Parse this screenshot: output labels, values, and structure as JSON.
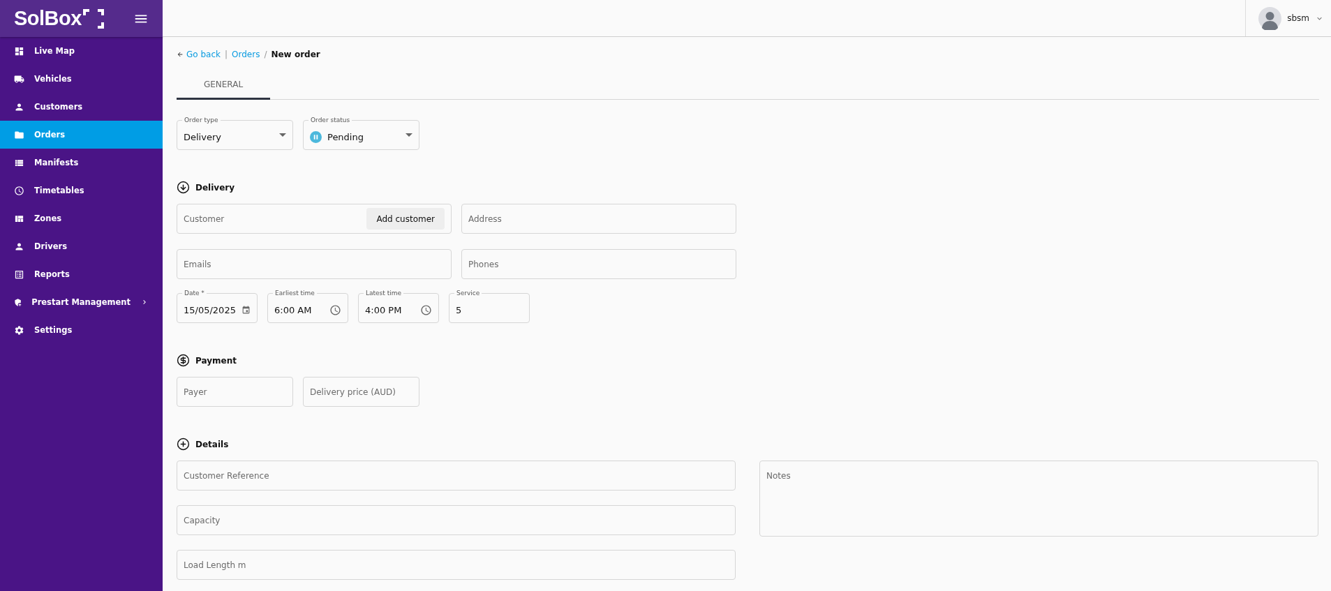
{
  "brand": {
    "name": "SolBox"
  },
  "sidebar": {
    "items": [
      {
        "label": "Live Map",
        "selected": false
      },
      {
        "label": "Vehicles",
        "selected": false
      },
      {
        "label": "Customers",
        "selected": false
      },
      {
        "label": "Orders",
        "selected": true
      },
      {
        "label": "Manifests",
        "selected": false
      },
      {
        "label": "Timetables",
        "selected": false
      },
      {
        "label": "Zones",
        "selected": false
      },
      {
        "label": "Drivers",
        "selected": false
      },
      {
        "label": "Reports",
        "selected": false
      },
      {
        "label": "Prestart Management",
        "selected": false,
        "has_submenu": true
      },
      {
        "label": "Settings",
        "selected": false
      }
    ]
  },
  "header": {
    "user": "sbsm"
  },
  "breadcrumb": {
    "back": "Go back",
    "separator": "|",
    "links": [
      "Orders"
    ],
    "divider": "/",
    "current": "New order"
  },
  "tabs": [
    {
      "label": "GENERAL",
      "selected": true
    }
  ],
  "selects": [
    {
      "label": "Order type",
      "value": "Delivery",
      "kind": "plain"
    },
    {
      "label": "Order status",
      "value": "Pending",
      "kind": "status"
    }
  ],
  "sections": [
    {
      "kind": "delivery",
      "title": "Delivery",
      "fields": [
        {
          "kind": "text",
          "placeholder": "Customer",
          "button": "Add customer"
        },
        {
          "kind": "text",
          "placeholder": "Address"
        },
        {
          "kind": "text",
          "placeholder": "Emails"
        },
        {
          "kind": "text",
          "placeholder": "Phones"
        },
        {
          "kind": "date",
          "label": "Date *",
          "value": "15/05/2025"
        },
        {
          "kind": "time",
          "label": "Earliest time",
          "value": "6:00 AM"
        },
        {
          "kind": "time",
          "label": "Latest time",
          "value": "4:00 PM"
        },
        {
          "kind": "number",
          "label": "Service",
          "value": "5"
        }
      ]
    },
    {
      "kind": "payment",
      "title": "Payment",
      "fields": [
        {
          "kind": "text",
          "placeholder": "Payer"
        },
        {
          "kind": "text",
          "placeholder": "Delivery price (AUD)"
        }
      ]
    },
    {
      "kind": "details",
      "title": "Details",
      "fields": [
        {
          "kind": "text",
          "placeholder": "Customer Reference"
        },
        {
          "kind": "text",
          "placeholder": "Capacity"
        },
        {
          "kind": "text",
          "placeholder": "Load Length m"
        },
        {
          "kind": "textarea",
          "placeholder": "Notes"
        }
      ]
    }
  ]
}
